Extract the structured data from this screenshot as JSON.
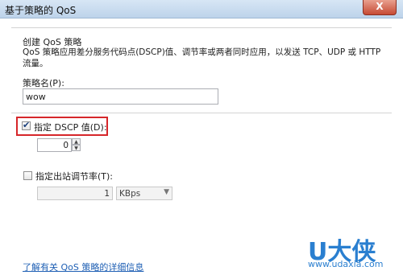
{
  "window": {
    "title": "基于策略的 QoS",
    "close_label": "X"
  },
  "form": {
    "heading": "创建 QoS 策略",
    "description": "QoS 策略应用差分服务代码点(DSCP)值、调节率或两者同时应用，以发送 TCP、UDP 或 HTTP 流量。",
    "policy_name_label": "策略名(P):",
    "policy_name_value": "wow",
    "dscp_checkbox_label": "指定 DSCP 值(D):",
    "dscp_checked": true,
    "dscp_value": "0",
    "throttle_checkbox_label": "指定出站调节率(T):",
    "throttle_checked": false,
    "throttle_value": "1",
    "throttle_unit": "KBps",
    "learn_more_link": "了解有关 QoS 策略的详细信息"
  },
  "watermark": {
    "brand": "U大侠",
    "url": "www.udaxia.com"
  },
  "colors": {
    "highlight": "#d6262a",
    "link": "#1e5fb4",
    "watermark": "#2a7fd0"
  }
}
